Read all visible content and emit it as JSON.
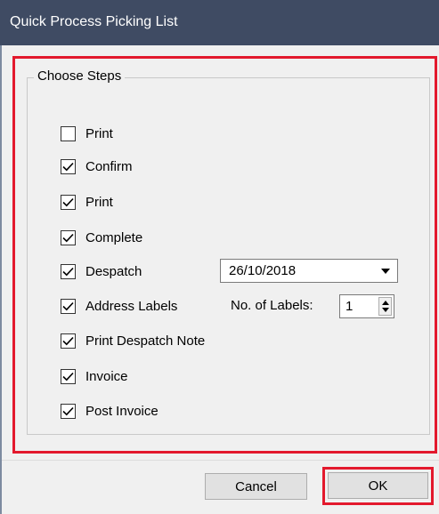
{
  "window": {
    "title": "Quick Process Picking List"
  },
  "group": {
    "legend": "Choose Steps"
  },
  "steps": [
    {
      "label": "Print",
      "checked": false
    },
    {
      "label": "Confirm",
      "checked": true
    },
    {
      "label": "Print",
      "checked": true
    },
    {
      "label": "Complete",
      "checked": true
    },
    {
      "label": "Despatch",
      "checked": true
    },
    {
      "label": "Address Labels",
      "checked": true
    },
    {
      "label": "Print Despatch Note",
      "checked": true
    },
    {
      "label": "Invoice",
      "checked": true
    },
    {
      "label": "Post Invoice",
      "checked": true
    }
  ],
  "despatch_date": {
    "value": "26/10/2018"
  },
  "labels_count": {
    "caption": "No. of Labels:",
    "value": "1"
  },
  "buttons": {
    "cancel": "Cancel",
    "ok": "OK"
  },
  "colors": {
    "titlebar": "#3f4b63",
    "highlight": "#e3192d"
  }
}
